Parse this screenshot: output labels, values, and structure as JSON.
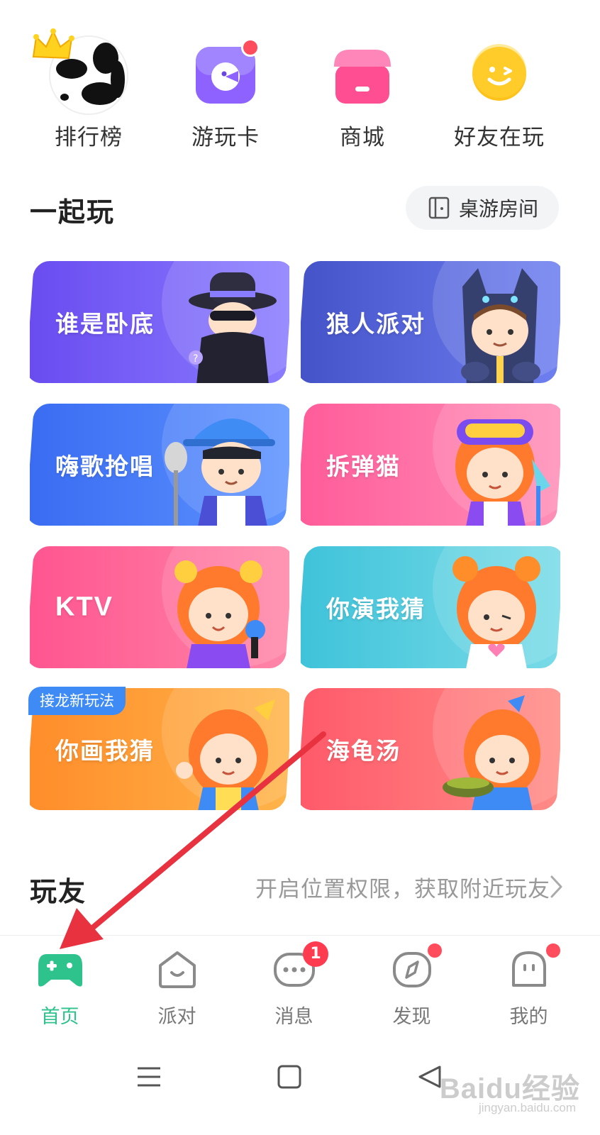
{
  "quick": [
    {
      "label": "排行榜",
      "icon": "ranking-avatar-icon"
    },
    {
      "label": "游玩卡",
      "icon": "play-card-icon"
    },
    {
      "label": "商城",
      "icon": "shop-icon"
    },
    {
      "label": "好友在玩",
      "icon": "friends-playing-icon"
    }
  ],
  "together": {
    "title": "一起玩",
    "room_button": "桌游房间"
  },
  "games": [
    {
      "label": "谁是卧底",
      "color_a": "#6a4cf0",
      "color_b": "#8a7cff"
    },
    {
      "label": "狼人派对",
      "color_a": "#4553c9",
      "color_b": "#6e7ff0"
    },
    {
      "label": "嗨歌抢唱",
      "color_a": "#3a6cf2",
      "color_b": "#5d93ff"
    },
    {
      "label": "拆弹猫",
      "color_a": "#ff5c9a",
      "color_b": "#ff8fb7"
    },
    {
      "label": "KTV",
      "color_a": "#ff5590",
      "color_b": "#ff86a8"
    },
    {
      "label": "你演我猜",
      "color_a": "#3fc3da",
      "color_b": "#79dbe7"
    },
    {
      "label": "你画我猜",
      "color_a": "#ff8d2a",
      "color_b": "#ffb44a"
    },
    {
      "label": "海龟汤",
      "color_a": "#ff5a6a",
      "color_b": "#ff8b86"
    }
  ],
  "new_tag": "接龙新玩法",
  "friends": {
    "title": "玩友",
    "nearby_link": "开启位置权限，获取附近玩友"
  },
  "tabs": [
    {
      "label": "首页",
      "icon": "gamepad-icon",
      "active": true
    },
    {
      "label": "派对",
      "icon": "party-icon"
    },
    {
      "label": "消息",
      "icon": "message-icon",
      "badge": "1"
    },
    {
      "label": "发现",
      "icon": "compass-icon"
    },
    {
      "label": "我的",
      "icon": "profile-icon"
    }
  ],
  "watermark": {
    "main": "Baidu经验",
    "sub": "jingyan.baidu.com"
  },
  "colors": {
    "accent": "#2ec28c",
    "badge": "#ff3b50",
    "arrow": "#e8323f"
  }
}
